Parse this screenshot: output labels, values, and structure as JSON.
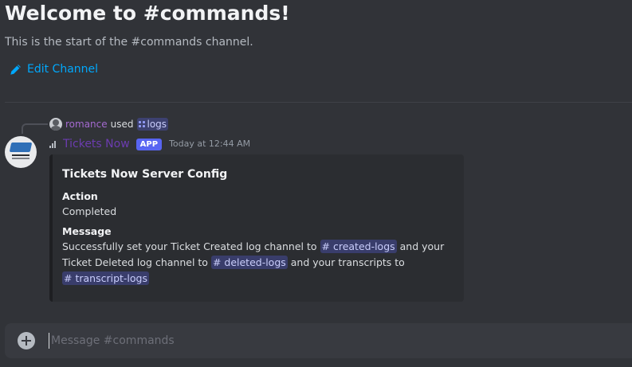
{
  "channel": {
    "welcome_title": "Welcome to #commands!",
    "welcome_subtitle": "This is the start of the #commands channel.",
    "edit_label": "Edit Channel"
  },
  "reply": {
    "user": "romance",
    "used": "used",
    "command": "logs"
  },
  "message": {
    "author": "Tickets Now",
    "badge": "APP",
    "timestamp": "Today at 12:44 AM",
    "embed": {
      "title": "Tickets Now Server Config",
      "fields": [
        {
          "name": "Action",
          "value": "Completed"
        },
        {
          "name": "Message",
          "text_1": "Successfully set your Ticket Created log channel to",
          "mention_1": "# created-logs",
          "text_2": "and your Ticket Deleted log channel to",
          "mention_2": "# deleted-logs",
          "text_3": "and your transcripts to",
          "mention_3": "# transcript-logs"
        }
      ]
    }
  },
  "composer": {
    "placeholder": "Message #commands"
  },
  "colors": {
    "background": "#313338",
    "link": "#00a8fc",
    "bot_name": "#6c3cb0",
    "reply_user": "#a46ad0",
    "badge": "#5865f2",
    "embed_bg": "#2b2d31",
    "mention_bg": "rgba(88,101,242,0.3)",
    "composer_bg": "#383a40"
  },
  "icons": {
    "edit": "pencil-icon",
    "slash": "slash-command-icon",
    "signal": "signal-bars-icon",
    "add": "plus-circle-icon"
  }
}
